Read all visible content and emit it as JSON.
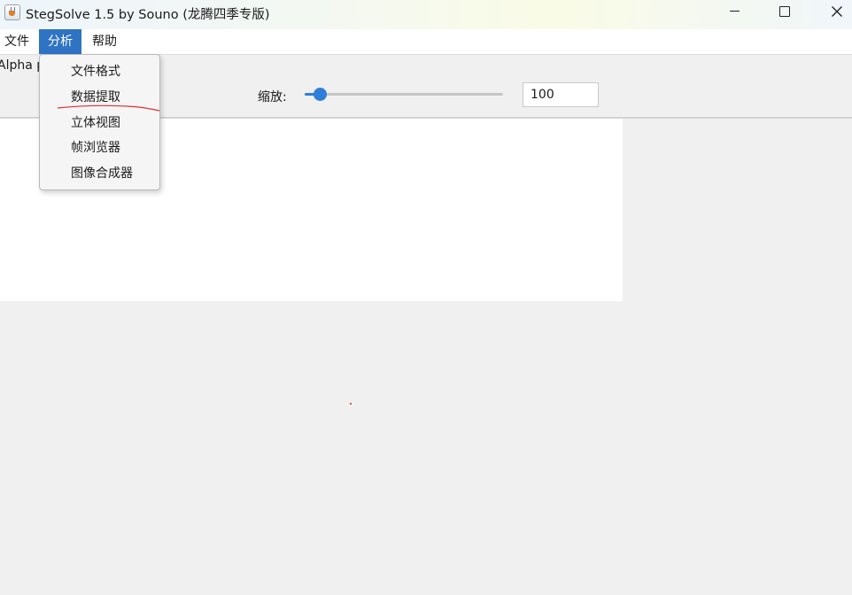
{
  "window": {
    "title": "StegSolve 1.5 by Souno (龙腾四季专版)",
    "icon": "java-cup-icon"
  },
  "menubar": {
    "items": [
      {
        "label": "文件"
      },
      {
        "label": "分析",
        "active": true
      },
      {
        "label": "帮助"
      }
    ]
  },
  "analyse_menu": {
    "items": [
      {
        "label": "文件格式"
      },
      {
        "label": "数据提取",
        "annotated": true
      },
      {
        "label": "立体视图"
      },
      {
        "label": "帧浏览器"
      },
      {
        "label": "图像合成器"
      }
    ]
  },
  "toolbar": {
    "channel_label_visible": "Alpha p",
    "zoom_label": "缩放:",
    "zoom_value": "100",
    "zoom_slider_percent": 8
  },
  "colors": {
    "menu_highlight": "#2f73c4",
    "slider_accent": "#2d7fd8",
    "annotation": "#e03030"
  }
}
